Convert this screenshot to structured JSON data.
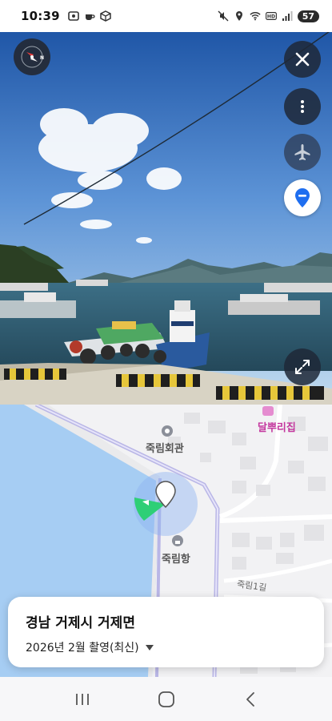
{
  "status_bar": {
    "time": "10:39",
    "battery": "57",
    "left_icons": [
      "screenshot-icon",
      "coffee-icon",
      "cube-icon"
    ],
    "right_icons": [
      "mute-icon",
      "location-icon",
      "wifi-icon",
      "hd-icon",
      "signal-icon"
    ]
  },
  "street_view": {
    "buttons": [
      "compass-icon",
      "close-icon",
      "more-vert-icon",
      "airplane-icon",
      "pin-icon",
      "expand-icon"
    ]
  },
  "map": {
    "pois": {
      "community_hall": "죽림회관",
      "harbor": "죽림항",
      "restaurant": "달뿌리집"
    },
    "road_label": "죽림1길",
    "colors": {
      "water": "#a6cdf3",
      "road": "#b9b6e6",
      "view_cone": "#2ecf76"
    }
  },
  "location_card": {
    "address": "경남 거제시 거제면",
    "capture_date": "2026년 2월 촬영(최신)"
  },
  "nav_bar": {
    "buttons": [
      "recent-apps-icon",
      "home-icon",
      "back-icon"
    ]
  }
}
